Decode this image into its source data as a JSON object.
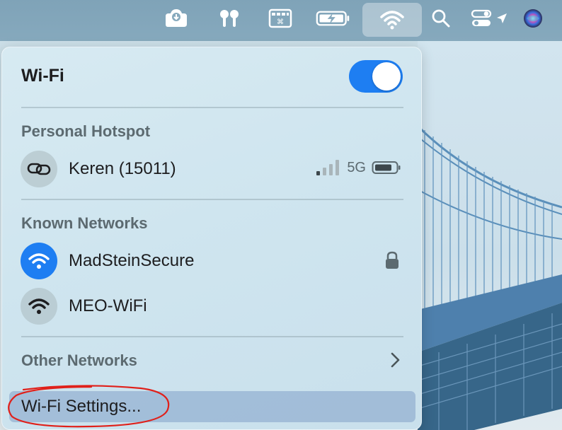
{
  "menubar": {
    "items": [
      {
        "id": "drive-sync",
        "icon": "cloud-download-icon"
      },
      {
        "id": "airpods",
        "icon": "airpods-icon"
      },
      {
        "id": "keyboard-viewer",
        "icon": "keyboard-cmd-icon"
      },
      {
        "id": "battery",
        "icon": "battery-charging-icon"
      },
      {
        "id": "wifi",
        "icon": "wifi-icon",
        "active": true
      },
      {
        "id": "spotlight",
        "icon": "search-icon"
      },
      {
        "id": "control-center",
        "icon": "control-center-icon"
      },
      {
        "id": "location",
        "icon": "location-arrow-icon"
      },
      {
        "id": "siri",
        "icon": "siri-icon"
      }
    ]
  },
  "wifi_panel": {
    "title": "Wi-Fi",
    "enabled": true,
    "personal_hotspot": {
      "label": "Personal Hotspot",
      "networks": [
        {
          "name": "Keren (15011)",
          "icon": "hotspot-link-icon",
          "signal_bars": 1,
          "signal_max": 4,
          "band": "5G",
          "battery_level": 0.75
        }
      ]
    },
    "known_networks": {
      "label": "Known Networks",
      "networks": [
        {
          "name": "MadSteinSecure",
          "icon": "wifi-icon",
          "connected": true,
          "locked": true
        },
        {
          "name": "MEO-WiFi",
          "icon": "wifi-icon",
          "connected": false,
          "locked": false
        }
      ]
    },
    "other_networks": {
      "label": "Other Networks"
    },
    "settings": {
      "label": "Wi-Fi Settings..."
    }
  },
  "colors": {
    "accent": "#1e7ef2",
    "annotation": "#e0201a",
    "menubar": "#82a6ba"
  }
}
